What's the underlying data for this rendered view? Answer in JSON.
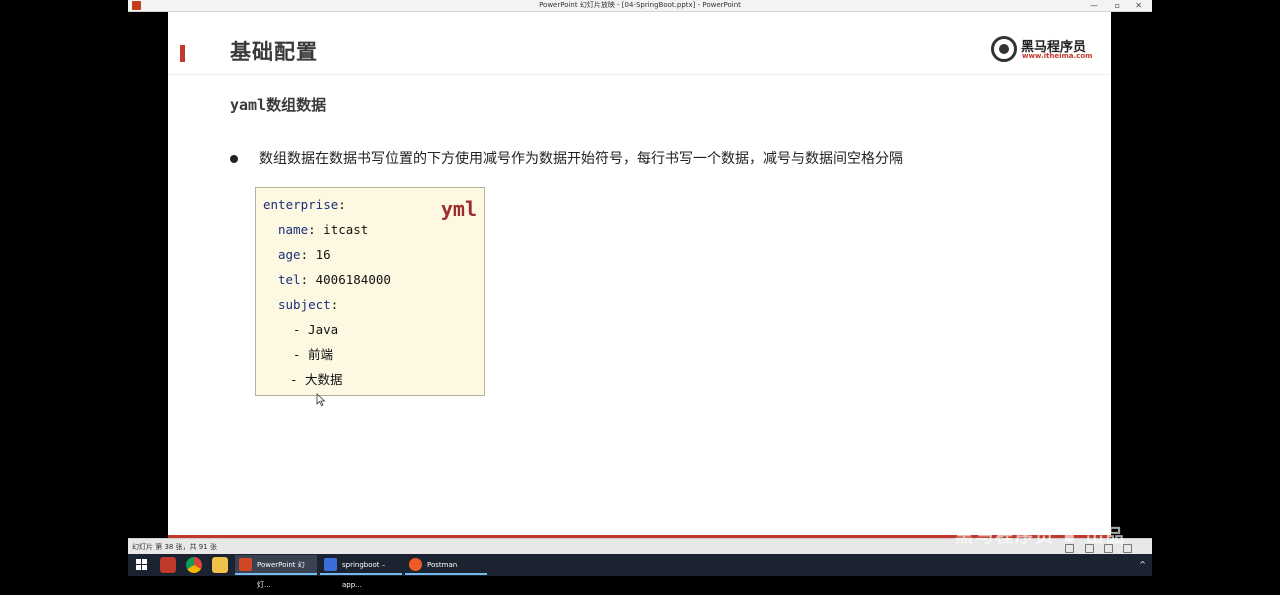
{
  "window": {
    "title": "PowerPoint 幻灯片放映 - [04-SpringBoot.pptx] - PowerPoint",
    "controls": [
      "—",
      "▫",
      "✕"
    ]
  },
  "slide": {
    "title": "基础配置",
    "logo_name": "黑马程序员",
    "logo_url": "www.itheima.com",
    "subtitle": "yaml数组数据",
    "bullet": "数组数据在数据书写位置的下方使用减号作为数据开始符号，每行书写一个数据，减号与数据间空格分隔",
    "code_tag": "yml",
    "code_lines": [
      {
        "key": "enterprise",
        "sep": ":",
        "value": ""
      },
      {
        "key": "name",
        "sep": ":",
        "value": " itcast"
      },
      {
        "key": "age",
        "sep": ":",
        "value": " 16"
      },
      {
        "key": "tel",
        "sep": ":",
        "value": " 4006184000"
      },
      {
        "key": "subject",
        "sep": ":",
        "value": ""
      },
      {
        "key": "",
        "sep": "",
        "value": "- Java"
      },
      {
        "key": "",
        "sep": "",
        "value": "- 前端"
      },
      {
        "key": "",
        "sep": "",
        "value": "- 大数据"
      }
    ],
    "accent_color": "#c0392b"
  },
  "statusbar": {
    "text": "幻灯片 第 38 张，共 91 张"
  },
  "watermark": "黑马程序员 ▪ 出品",
  "taskbar": {
    "items": [
      {
        "label": "PowerPoint 幻灯...",
        "icon": "powerpoint-icon",
        "color": "#d24726",
        "active": true
      },
      {
        "label": "springboot – app...",
        "icon": "intellij-icon",
        "color": "#3c6edb",
        "active": false
      },
      {
        "label": "Postman",
        "icon": "postman-icon",
        "color": "#ef5b25",
        "active": false
      }
    ],
    "tray_icon": "chevron-up-icon"
  }
}
